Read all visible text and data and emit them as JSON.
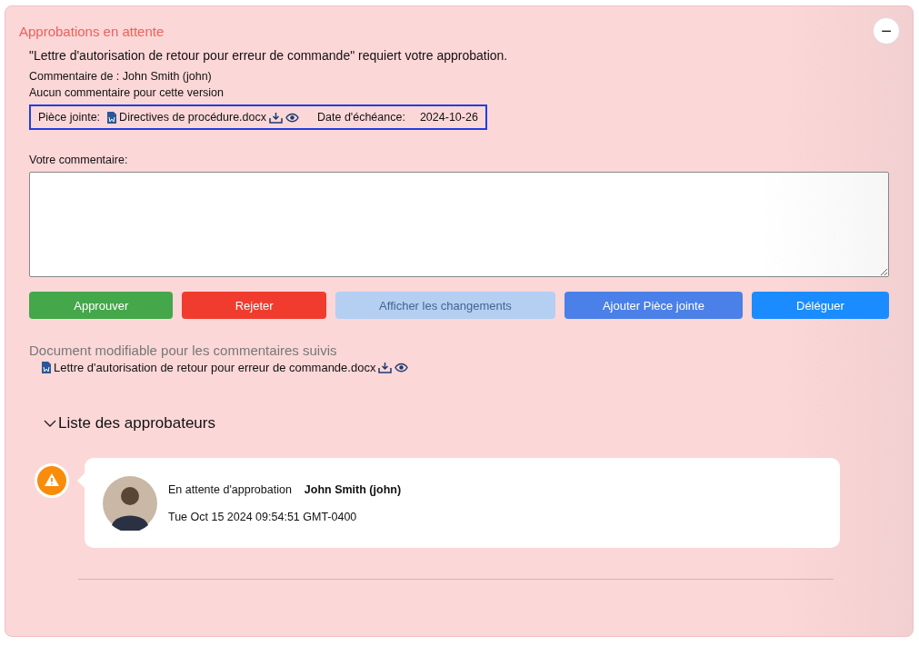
{
  "panel": {
    "title": "Approbations en attente",
    "collapse_button": "−"
  },
  "request": {
    "message": "\"Lettre d'autorisation de retour pour erreur de commande\" requiert votre approbation.",
    "comment_by": "Commentaire de : John Smith (john)",
    "comment": "Aucun commentaire pour cette version",
    "attachment_label": "Pièce jointe:",
    "attachment_file": "Directives de procédure.docx",
    "due_label": "Date d'échéance:",
    "due_date": "2024-10-26"
  },
  "comment_field": {
    "label": "Votre commentaire:"
  },
  "buttons": [
    {
      "label": "Approuver",
      "color": "#44a74a",
      "disabled": false
    },
    {
      "label": "Rejeter",
      "color": "#f03c2f",
      "disabled": false
    },
    {
      "label": "Afficher les changements",
      "color": "#b5cff2",
      "disabled": true
    },
    {
      "label": "Ajouter Pièce jointe",
      "color": "#4a80e8",
      "disabled": false
    },
    {
      "label": "Déléguer",
      "color": "#1a8cff",
      "disabled": false
    }
  ],
  "editable_document": {
    "heading": "Document modifiable pour les commentaires suivis",
    "file": "Lettre d'autorisation de retour pour erreur de commande.docx"
  },
  "approvers": {
    "heading": "Liste des approbateurs",
    "expanded": true,
    "items": [
      {
        "status": "En attente d'approbation",
        "name": "John Smith (john)",
        "date": "Tue Oct 15 2024 09:54:51 GMT-0400"
      }
    ]
  }
}
